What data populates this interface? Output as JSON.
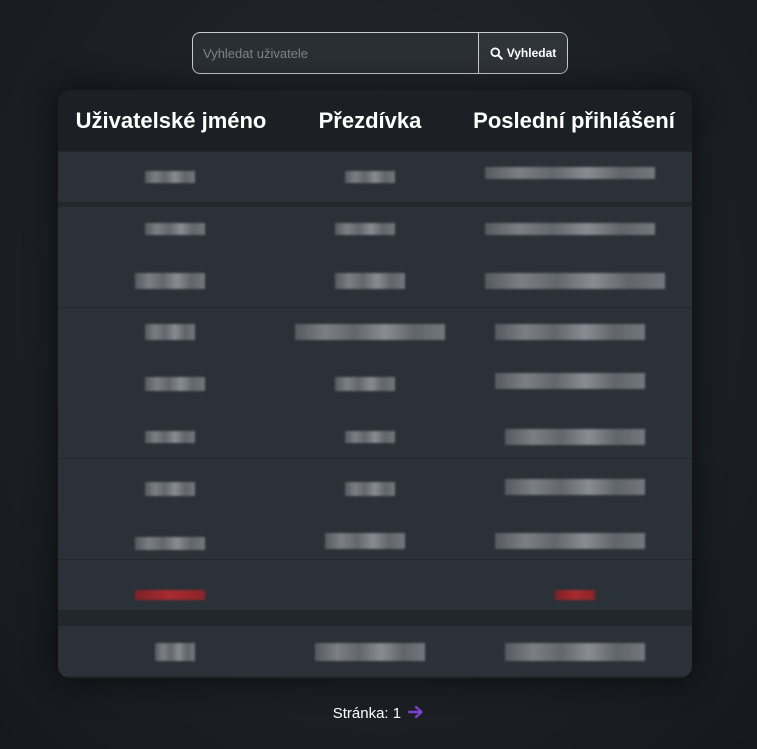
{
  "search": {
    "placeholder": "Vyhledat uživatele",
    "value": "",
    "button_label": "Vyhledat",
    "button_icon": "search-icon"
  },
  "table": {
    "columns": [
      "Uživatelské jméno",
      "Přezdívka",
      "Poslední přihlášení"
    ],
    "rows": [
      {
        "username": "",
        "nickname": "",
        "last_login": ""
      },
      {
        "username": "",
        "nickname": "",
        "last_login": ""
      },
      {
        "username": "",
        "nickname": "",
        "last_login": ""
      },
      {
        "username": "",
        "nickname": "",
        "last_login": ""
      },
      {
        "username": "",
        "nickname": "",
        "last_login": ""
      },
      {
        "username": "",
        "nickname": "",
        "last_login": ""
      },
      {
        "username": "",
        "nickname": "",
        "last_login": ""
      },
      {
        "username": "",
        "nickname": "",
        "last_login": ""
      },
      {
        "username": "",
        "nickname": "",
        "last_login": ""
      },
      {
        "username": "",
        "nickname": "",
        "last_login": ""
      }
    ]
  },
  "pagination": {
    "label": "Stránka:",
    "page": "1",
    "next_icon": "arrow-right-icon",
    "arrow_color": "#7c3fd0"
  },
  "colors": {
    "background": "#1d2126",
    "panel": "#22272c",
    "row": "#2b3138",
    "highlight_red": "#c02a2f"
  }
}
